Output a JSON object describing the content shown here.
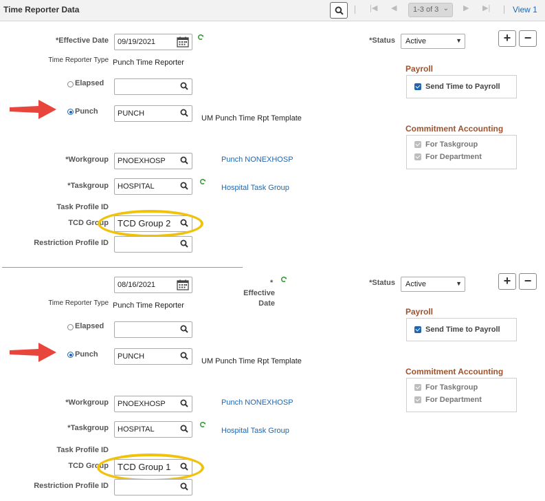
{
  "header": {
    "title": "Time Reporter Data",
    "pager_text": "1-3 of 3",
    "view_link": "View 1",
    "icons": [
      "search-icon",
      "first-icon",
      "prev-icon",
      "next-icon",
      "last-icon"
    ]
  },
  "labels": {
    "effective_date": "*Effective Date",
    "effective_date_req": "*",
    "effective_date_split_1": "Effective",
    "effective_date_split_2": "Date",
    "time_reporter_type": "Time Reporter Type",
    "elapsed": "Elapsed",
    "punch": "Punch",
    "workgroup": "*Workgroup",
    "taskgroup": "*Taskgroup",
    "task_profile_id": "Task Profile ID",
    "tcd_group": "TCD Group",
    "restriction_profile_id": "Restriction Profile ID",
    "status": "*Status",
    "payroll": "Payroll",
    "send_time_to_payroll": "Send Time to Payroll",
    "commitment_accounting": "Commitment Accounting",
    "for_taskgroup": "For Taskgroup",
    "for_department": "For Department",
    "add": "+",
    "remove": "−"
  },
  "rows": [
    {
      "effective_date": "09/19/2021",
      "time_reporter_type_value": "Punch Time Reporter",
      "elapsed_value": "",
      "punch_value": "PUNCH",
      "punch_desc": "UM Punch Time Rpt Template",
      "workgroup_value": "PNOEXHOSP",
      "workgroup_desc": "Punch NONEXHOSP",
      "taskgroup_value": "HOSPITAL",
      "taskgroup_desc": "Hospital Task Group",
      "tcd_group_value": "TCD Group 2",
      "restriction_value": "",
      "status_value": "Active",
      "send_time_to_payroll": true,
      "for_taskgroup": true,
      "for_department": true
    },
    {
      "effective_date": "08/16/2021",
      "time_reporter_type_value": "Punch Time Reporter",
      "elapsed_value": "",
      "punch_value": "PUNCH",
      "punch_desc": "UM Punch Time Rpt Template",
      "workgroup_value": "PNOEXHOSP",
      "workgroup_desc": "Punch NONEXHOSP",
      "taskgroup_value": "HOSPITAL",
      "taskgroup_desc": "Hospital Task Group",
      "tcd_group_value": "TCD Group 1",
      "restriction_value": "",
      "status_value": "Active",
      "send_time_to_payroll": true,
      "for_taskgroup": true,
      "for_department": true
    }
  ],
  "annotations": {
    "arrow_color": "#e8453c",
    "oval_color": "#f0c20c"
  },
  "colors": {
    "link": "#1f66b0",
    "section_heading": "#a0522d",
    "checkbox_on": "#1f66b0",
    "checkbox_disabled": "#bdbdbd"
  }
}
